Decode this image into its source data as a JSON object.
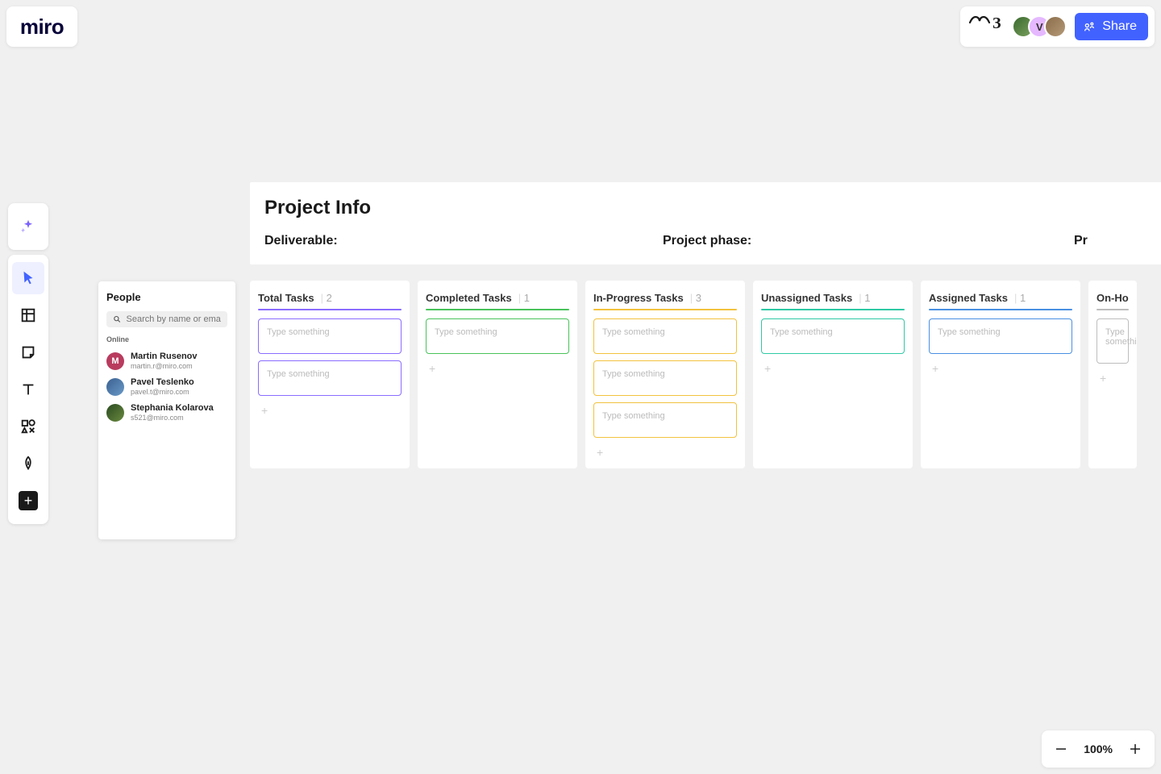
{
  "app": {
    "logo": "miro"
  },
  "topbar": {
    "share_label": "Share",
    "avatars": [
      {
        "bg": "#5b8a3a",
        "initial": ""
      },
      {
        "bg": "#e5b8ff",
        "initial": "V"
      },
      {
        "bg": "#8a6d4a",
        "initial": ""
      }
    ]
  },
  "toolbar": {
    "ai": "ai",
    "cursor": "select",
    "frame": "frame",
    "sticky": "sticky",
    "text": "text",
    "shapes": "shapes",
    "pen": "pen",
    "add": "+"
  },
  "people": {
    "title": "People",
    "search_placeholder": "Search by name or email",
    "section_online": "Online",
    "list": [
      {
        "name": "Martin Rusenov",
        "email": "martin.r@miro.com",
        "avatarBg": "#b83b5e",
        "initial": "M"
      },
      {
        "name": "Pavel Teslenko",
        "email": "pavel.t@miro.com",
        "avatarBg": "#4a7ab0",
        "initial": ""
      },
      {
        "name": "Stephania Kolarova",
        "email": "s521@miro.com",
        "avatarBg": "#3a5a30",
        "initial": ""
      }
    ]
  },
  "project": {
    "title": "Project Info",
    "deliverable_label": "Deliverable:",
    "phase_label": "Project phase:",
    "extra_label": "Pr"
  },
  "columns": [
    {
      "title": "Total Tasks",
      "count": "2",
      "color": "#8a6cff",
      "cards": 2
    },
    {
      "title": "Completed Tasks",
      "count": "1",
      "color": "#49c35a",
      "cards": 1
    },
    {
      "title": "In-Progress Tasks",
      "count": "3",
      "color": "#f2c23e",
      "cards": 3
    },
    {
      "title": "Unassigned Tasks",
      "count": "1",
      "color": "#2fc9a5",
      "cards": 1
    },
    {
      "title": "Assigned Tasks",
      "count": "1",
      "color": "#4a90e2",
      "cards": 1
    },
    {
      "title": "On-Ho",
      "count": "",
      "color": "#bdbdbd",
      "cards": 1
    }
  ],
  "card_placeholder": "Type something",
  "zoom": {
    "level": "100%"
  }
}
